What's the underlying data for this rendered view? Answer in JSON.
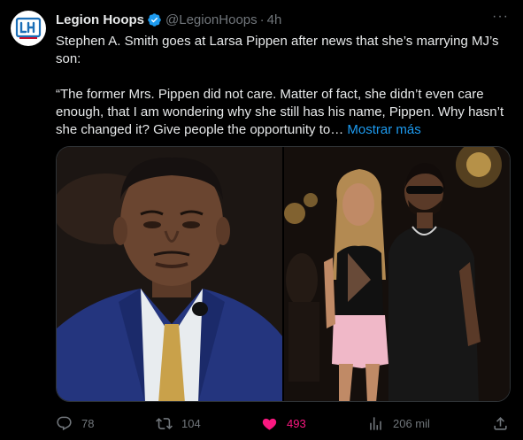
{
  "author": {
    "name": "Legion Hoops",
    "handle": "@LegionHoops",
    "separator": "·",
    "time": "4h",
    "more_label": "···"
  },
  "tweet": {
    "text": "Stephen A. Smith goes at Larsa Pippen after news that she’s marrying MJ’s son:\n\n“The former Mrs. Pippen did not care. Matter of fact, she didn’t even care enough, that I am wondering why she still has his name, Pippen. Why hasn’t she changed it? Give people the opportunity to… ",
    "show_more": "Mostrar más"
  },
  "media": {
    "photos": [
      "photo-stephen-a-smith",
      "photo-couple"
    ]
  },
  "actions": {
    "replies": "78",
    "retweets": "104",
    "likes": "493",
    "views": "206 mil"
  },
  "colors": {
    "background": "#000000",
    "text": "#e7e9ea",
    "muted": "#71767b",
    "accent": "#1d9bf0",
    "like": "#f91880"
  }
}
